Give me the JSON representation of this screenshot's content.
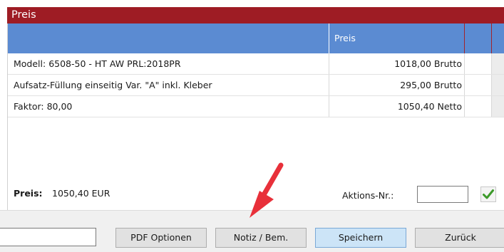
{
  "window": {
    "title": "Preis"
  },
  "table": {
    "price_header": "Preis",
    "rows": [
      {
        "description": "Modell: 6508-50 - HT AW PRL:2018PR",
        "price": "1018,00 Brutto"
      },
      {
        "description": "Aufsatz-Füllung einseitig Var. \"A\" inkl. Kleber",
        "price": "295,00 Brutto"
      },
      {
        "description": "Faktor: 80,00",
        "price": "1050,40 Netto"
      }
    ]
  },
  "summary": {
    "label": "Preis:",
    "value": "1050,40 EUR",
    "aktion_label": "Aktions-Nr.:",
    "aktion_value": ""
  },
  "buttons": {
    "pdf_options": "PDF Optionen",
    "note": "Notiz / Bem.",
    "save": "Speichern",
    "back": "Zurück"
  },
  "bottom_input": {
    "value": ""
  },
  "colors": {
    "title_bar": "#9e1c24",
    "table_header": "#5b8bd2",
    "annotation_arrow": "#e8303a",
    "check": "#3c9a2a"
  },
  "icons": {
    "confirm": "checkmark-icon",
    "annotation": "red-arrow-annotation"
  }
}
